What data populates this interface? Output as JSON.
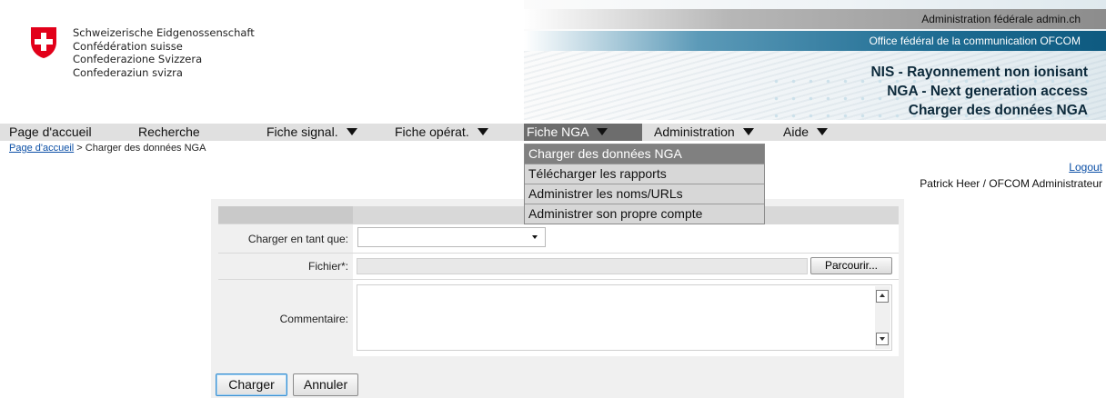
{
  "header": {
    "gov_names": [
      "Schweizerische Eidgenossenschaft",
      "Confédération suisse",
      "Confederazione Svizzera",
      "Confederaziun svizra"
    ],
    "admin_line": "Administration fédérale admin.ch",
    "office_line": "Office fédéral de la communication OFCOM",
    "titles": [
      "NIS - Rayonnement non ionisant",
      "NGA - Next generation access",
      "Charger des données NGA"
    ],
    "colors": {
      "office_blue": "#1f6d93",
      "swiss_red": "#e2001a"
    }
  },
  "nav": {
    "items": [
      {
        "label": "Page d'accueil",
        "dropdown": false
      },
      {
        "label": "Recherche",
        "dropdown": false
      },
      {
        "label": "Fiche signal.",
        "dropdown": true
      },
      {
        "label": "Fiche opérat.",
        "dropdown": true
      },
      {
        "label": "Fiche NGA",
        "dropdown": true,
        "active": true
      },
      {
        "label": "Administration",
        "dropdown": true
      },
      {
        "label": "Aide",
        "dropdown": true
      }
    ],
    "open_menu": [
      "Charger des données NGA",
      "Télécharger les rapports",
      "Administrer les noms/URLs",
      "Administrer son propre compte"
    ]
  },
  "breadcrumb": {
    "home": "Page d'accueil",
    "separator": " > ",
    "current": "Charger des données NGA"
  },
  "user": {
    "logout": "Logout",
    "name": "Patrick Heer / OFCOM Administrateur"
  },
  "form": {
    "type_label": "Charger en tant que:",
    "type_value": "",
    "file_label": "Fichier*:",
    "file_value": "",
    "browse_label": "Parcourir...",
    "comment_label": "Commentaire:",
    "comment_value": "",
    "submit_label": "Charger",
    "cancel_label": "Annuler"
  }
}
